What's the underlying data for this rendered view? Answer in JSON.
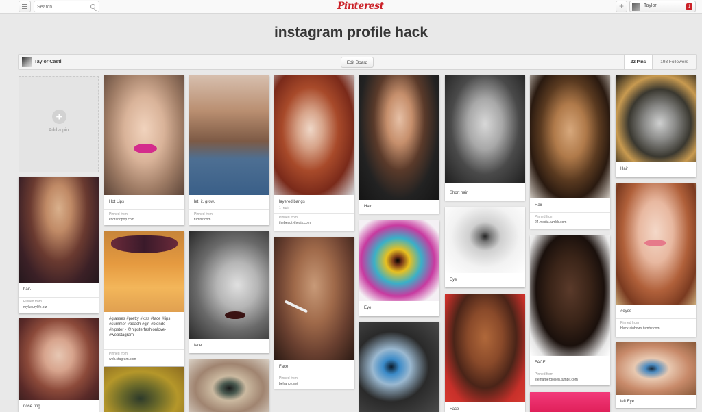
{
  "header": {
    "search_placeholder": "Search",
    "logo": "Pinterest",
    "add_symbol": "+",
    "user_name": "Taylor",
    "notification_count": "1"
  },
  "board": {
    "title": "instagram profile hack",
    "owner": "Taylor Casti",
    "edit_label": "Edit Board",
    "pins_count": "22 Pins",
    "followers_count": "193 Followers"
  },
  "add_pin": {
    "icon": "plus-icon",
    "label": "Add a pin"
  },
  "pins": [
    {
      "desc": "hair.",
      "pinned_from": "Pinned from",
      "source": "myluxurylife.biz"
    },
    {
      "desc": "nose ring"
    },
    {
      "desc": "Hot Lips",
      "pinned_from": "Pinned from",
      "source": "knotandpop.com"
    },
    {
      "desc": "#glasses #pretty #kiss #face #lips #summer #beach #girl #blonde #hipster - @hipsterfashionlove- #webstagram",
      "pinned_from": "Pinned from",
      "source": "web.stagram.com"
    },
    {
      "desc": "let. it. grow.",
      "pinned_from": "Pinned from",
      "source": "tumblr.com"
    },
    {
      "desc": "face"
    },
    {
      "desc": "layered bangs",
      "repin": "1 repin",
      "pinned_from": "Pinned from",
      "source": "thebeautythesis.com"
    },
    {
      "desc": "Face",
      "pinned_from": "Pinned from",
      "source": "behance.net"
    },
    {
      "desc": "Hair"
    },
    {
      "desc": "Eye"
    },
    {
      "desc": "Short hair"
    },
    {
      "desc": "Eye"
    },
    {
      "desc": "Face"
    },
    {
      "desc": "Hair",
      "pinned_from": "Pinned from",
      "source": "24.media.tumblr.com"
    },
    {
      "desc": "FACE",
      "pinned_from": "Pinned from",
      "source": "steinarbergoisen.tumblr.com"
    },
    {
      "desc": "Hair"
    },
    {
      "desc": "#eyes",
      "pinned_from": "Pinned from",
      "source": "blackrainbows.tumblr.com"
    },
    {
      "desc": "left Eye"
    }
  ]
}
